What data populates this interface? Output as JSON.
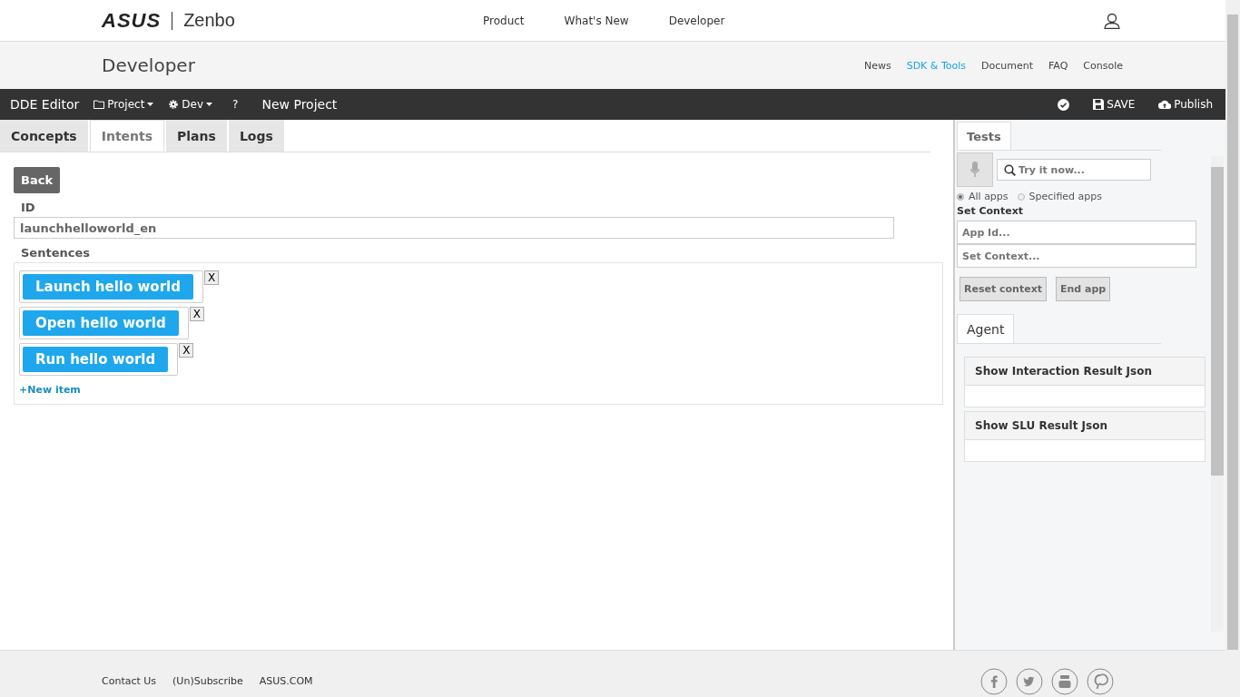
{
  "header": {
    "logo": "ASUS",
    "product": "Zenbo",
    "nav": [
      "Product",
      "What's New",
      "Developer"
    ]
  },
  "subheader": {
    "title": "Developer",
    "links": [
      {
        "label": "News",
        "selected": false
      },
      {
        "label": "SDK & Tools",
        "selected": true
      },
      {
        "label": "Document",
        "selected": false
      },
      {
        "label": "FAQ",
        "selected": false
      },
      {
        "label": "Console",
        "selected": false
      }
    ]
  },
  "toolbar": {
    "title": "DDE Editor",
    "menus": [
      {
        "kind": "folder",
        "label": "Project"
      },
      {
        "kind": "gear",
        "label": "Dev"
      }
    ],
    "help": "?",
    "project_name": "New Project",
    "save": "SAVE",
    "publish": "Publish"
  },
  "tabs": [
    {
      "label": "Concepts",
      "selected": false
    },
    {
      "label": "Intents",
      "selected": true
    },
    {
      "label": "Plans",
      "selected": false
    },
    {
      "label": "Logs",
      "selected": false
    }
  ],
  "editor": {
    "back": "Back",
    "id_label": "ID",
    "id_value": "launchhelloworld_en",
    "sentences_label": "Sentences",
    "sentences": [
      {
        "text": "Launch hello world",
        "remove": "X"
      },
      {
        "text": "Open hello world",
        "remove": "X"
      },
      {
        "text": "Run hello world",
        "remove": "X"
      }
    ],
    "new_item": "+New item"
  },
  "tests": {
    "tab": "Tests",
    "search_placeholder": "Try it now...",
    "scope": [
      {
        "label": "All apps",
        "selected": true
      },
      {
        "label": "Specified apps",
        "selected": false
      }
    ],
    "context_label": "Set Context",
    "app_id_placeholder": "App Id...",
    "context_placeholder": "Set Context...",
    "buttons": [
      "Reset context",
      "End app"
    ],
    "agent_tab": "Agent",
    "panels": [
      "Show Interaction Result Json",
      "Show SLU Result Json"
    ]
  },
  "footer": {
    "links": [
      "Contact Us",
      "(Un)Subscribe",
      "ASUS.COM"
    ]
  }
}
